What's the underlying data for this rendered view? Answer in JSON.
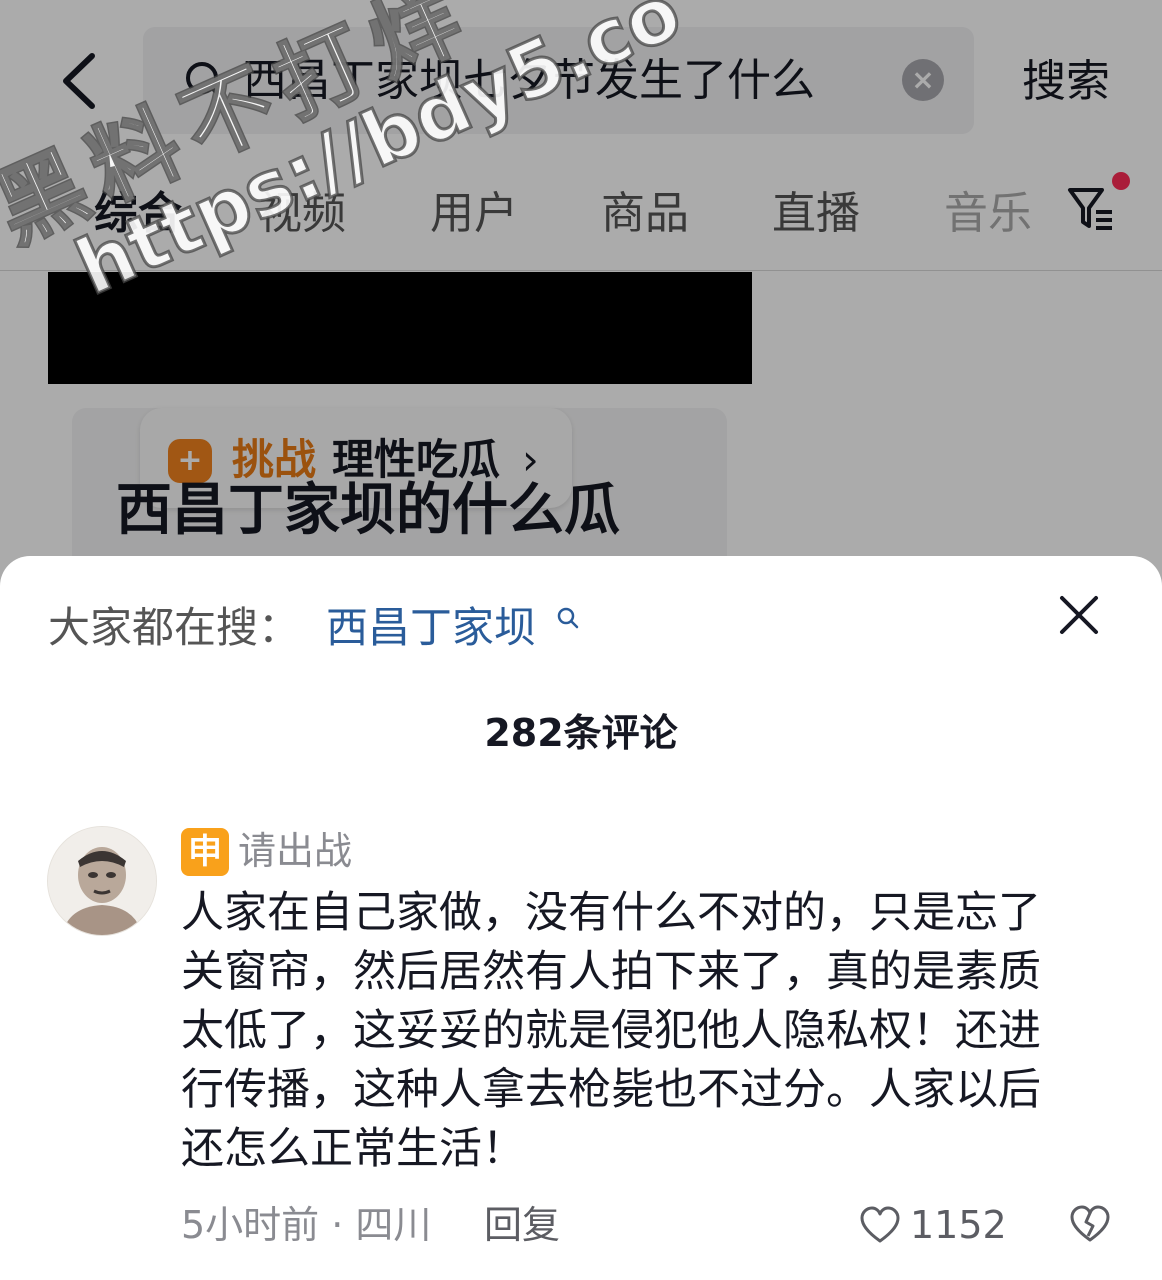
{
  "search": {
    "query": "西昌丁家坝七夕节发生了什么",
    "submit_label": "搜索"
  },
  "tabs": [
    "综合",
    "视频",
    "用户",
    "商品",
    "直播",
    "音乐"
  ],
  "result_card": {
    "challenge_tag": "挑战",
    "challenge_text": "理性吃瓜",
    "title": "西昌丁家坝的什么瓜"
  },
  "watermark": {
    "line1": "黑料不打烊",
    "line2": "https://bdy5.co"
  },
  "comments_sheet": {
    "everyone_searching_label": "大家都在搜：",
    "everyone_searching_link": "西昌丁家坝",
    "count_label": "282条评论",
    "comment": {
      "badge": "申",
      "username": "请出战",
      "lines": [
        "人家在自己家做，没有什么不对的，只是忘了",
        "关窗帘，然后居然有人拍下来了，真的是素质",
        "太低了，这妥妥的就是侵犯他人隐私权！还进",
        "行传播，这种人拿去枪毙也不过分。人家以后",
        "还怎么正常生活！"
      ],
      "meta": "5小时前 · 四川",
      "reply_label": "回复",
      "likes": "1152"
    }
  },
  "colors": {
    "accent_link": "#2a5c9a",
    "challenge_orange": "#e77b16",
    "badge_orange": "#f9a11b",
    "notification_dot": "#fe2c55"
  }
}
